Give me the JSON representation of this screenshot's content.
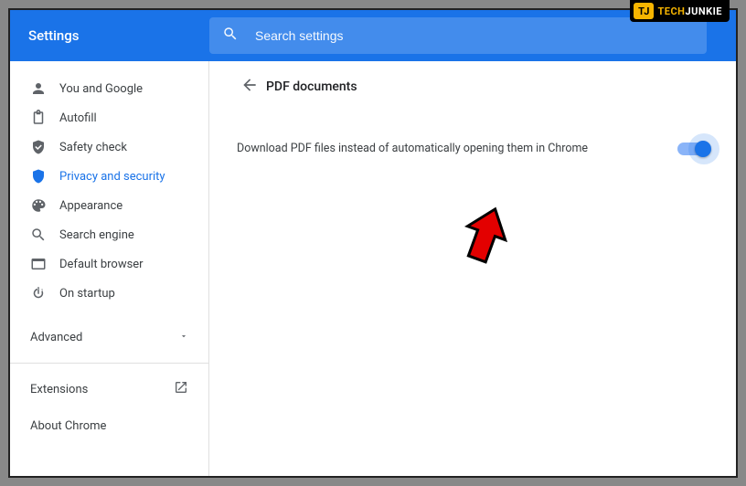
{
  "brand": {
    "badge": "TJ",
    "part1": "TECH",
    "part2": "JUNKIE"
  },
  "header": {
    "title": "Settings"
  },
  "search": {
    "placeholder": "Search settings"
  },
  "sidebar": {
    "items": [
      {
        "label": "You and Google"
      },
      {
        "label": "Autofill"
      },
      {
        "label": "Safety check"
      },
      {
        "label": "Privacy and security"
      },
      {
        "label": "Appearance"
      },
      {
        "label": "Search engine"
      },
      {
        "label": "Default browser"
      },
      {
        "label": "On startup"
      }
    ],
    "advanced": "Advanced",
    "extensions": "Extensions",
    "about": "About Chrome"
  },
  "page": {
    "title": "PDF documents",
    "setting_label": "Download PDF files instead of automatically opening them in Chrome",
    "toggle_on": true
  }
}
